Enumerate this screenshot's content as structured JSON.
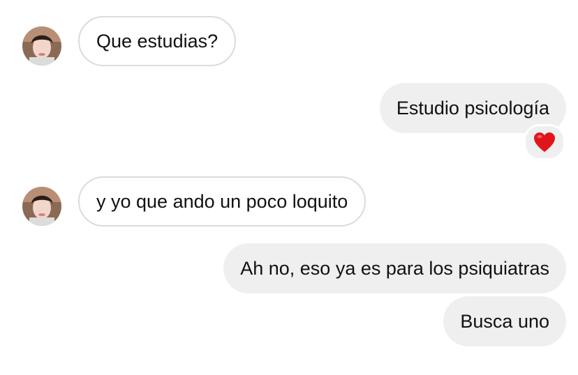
{
  "messages": [
    {
      "sender": "other",
      "text": "Que estudias?"
    },
    {
      "sender": "me",
      "text": "Estudio psicología",
      "reaction": "heart-emoji"
    },
    {
      "sender": "other",
      "text": "y yo que ando un poco loquito"
    },
    {
      "sender": "me",
      "text": "Ah no, eso ya es para los psiquiatras"
    },
    {
      "sender": "me",
      "text": "Busca uno"
    }
  ],
  "colors": {
    "sent_bubble": "#efefef",
    "received_border": "#dbdbdb",
    "text": "#111111",
    "reaction_heart": "#e0151b"
  }
}
